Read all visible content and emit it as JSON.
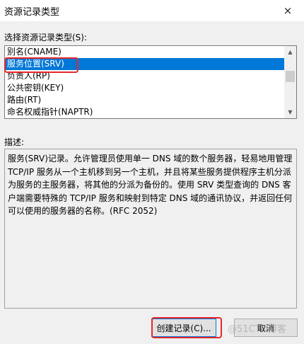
{
  "window": {
    "title": "资源记录类型",
    "close_icon": "×"
  },
  "select_label": "选择资源记录类型(S):",
  "list_items": [
    {
      "label": "别名(CNAME)",
      "selected": false
    },
    {
      "label": "服务位置(SRV)",
      "selected": true
    },
    {
      "label": "负责人(RP)",
      "selected": false
    },
    {
      "label": "公共密钥(KEY)",
      "selected": false
    },
    {
      "label": "路由(RT)",
      "selected": false
    },
    {
      "label": "命名权威指针(NAPTR)",
      "selected": false
    }
  ],
  "scrollbar": {
    "up_arrow": "▲",
    "down_arrow": "▼"
  },
  "description_label": "描述:",
  "description_text": "服务(SRV)记录。允许管理员使用单一 DNS 域的数个服务器，轻易地用管理 TCP/IP 服务从一个主机移到另一个主机，并且将某些服务提供程序主机分派为服务的主服务器，将其他的分派为备份的。使用 SRV 类型查询的 DNS 客户端需要特殊的 TCP/IP 服务和映射到特定 DNS 域的通讯协议，并返回任何可以使用的服务器的名称。(RFC 2052)",
  "buttons": {
    "create": "创建记录(C)...",
    "cancel": "取消"
  },
  "watermark": "@51CTO博客",
  "colors": {
    "selection": "#0078d7",
    "highlight": "#e8262b"
  }
}
